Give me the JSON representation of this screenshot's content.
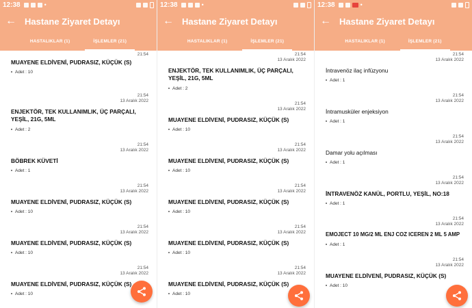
{
  "status_bar": {
    "time": "12:38"
  },
  "app_bar": {
    "back_icon": "arrow-left-icon",
    "title": "Hastane Ziyaret Detayı"
  },
  "tabs": [
    {
      "label": "HASTALIKLAR (1)",
      "active": false
    },
    {
      "label": "İŞLEMLER (21)",
      "active": true
    }
  ],
  "colors": {
    "header": "#f6ad86",
    "fab": "#ff6f3c"
  },
  "fab": {
    "icon": "share-icon"
  },
  "panels": [
    {
      "items": [
        {
          "time": "21:54",
          "date": "",
          "name": "MUAYENE ELDİVENİ, PUDRASIZ, KÜÇÜK (S)",
          "qty": "Adet : 10"
        },
        {
          "time": "21:54",
          "date": "13 Aralık 2022",
          "name": "ENJEKTÖR, TEK KULLANIMLIK, ÜÇ PARÇALI, YEŞİL, 21G, 5ML",
          "qty": "Adet : 2"
        },
        {
          "time": "21:54",
          "date": "13 Aralık 2022",
          "name": "BÖBREK KÜVETİ",
          "qty": "Adet : 1"
        },
        {
          "time": "21:54",
          "date": "13 Aralık 2022",
          "name": "MUAYENE ELDİVENİ, PUDRASIZ, KÜÇÜK (S)",
          "qty": "Adet : 10"
        },
        {
          "time": "21:54",
          "date": "13 Aralık 2022",
          "name": "MUAYENE ELDİVENİ, PUDRASIZ, KÜÇÜK (S)",
          "qty": "Adet : 10"
        },
        {
          "time": "21:54",
          "date": "13 Aralık 2022",
          "name": "MUAYENE ELDİVENİ, PUDRASIZ, KÜÇÜK (S)",
          "qty": "Adet : 10"
        }
      ]
    },
    {
      "items": [
        {
          "time": "21:54",
          "date": "13 Aralık 2022",
          "name": "ENJEKTÖR, TEK KULLANIMLIK, ÜÇ PARÇALI, YEŞİL, 21G, 5ML",
          "qty": "Adet : 2"
        },
        {
          "time": "21:54",
          "date": "13 Aralık 2022",
          "name": "MUAYENE ELDİVENİ, PUDRASIZ, KÜÇÜK (S)",
          "qty": "Adet : 10"
        },
        {
          "time": "21:54",
          "date": "13 Aralık 2022",
          "name": "MUAYENE ELDİVENİ, PUDRASIZ, KÜÇÜK (S)",
          "qty": "Adet : 10"
        },
        {
          "time": "21:54",
          "date": "13 Aralık 2022",
          "name": "MUAYENE ELDİVENİ, PUDRASIZ, KÜÇÜK (S)",
          "qty": "Adet : 10"
        },
        {
          "time": "21:54",
          "date": "13 Aralık 2022",
          "name": "MUAYENE ELDİVENİ, PUDRASIZ, KÜÇÜK (S)",
          "qty": "Adet : 10"
        },
        {
          "time": "21:54",
          "date": "13 Aralık 2022",
          "name": "MUAYENE ELDİVENİ, PUDRASIZ, KÜÇÜK (S)",
          "qty": "Adet : 10"
        }
      ]
    },
    {
      "items": [
        {
          "time": "21:54",
          "date": "13 Aralık 2022",
          "name": "İntravenöz ilaç infüzyonu",
          "qty": "Adet : 1"
        },
        {
          "time": "21:54",
          "date": "13 Aralık 2022",
          "name": "İntramusküler enjeksiyon",
          "qty": "Adet : 1"
        },
        {
          "time": "21:54",
          "date": "13 Aralık 2022",
          "name": "Damar yolu açılması",
          "qty": "Adet : 1"
        },
        {
          "time": "21:54",
          "date": "13 Aralık 2022",
          "name": "İNTRAVENÖZ KANÜL, PORTLU, YEŞİL, NO:18",
          "qty": "Adet : 1"
        },
        {
          "time": "21:54",
          "date": "13 Aralık 2022",
          "name": "EMOJECT 10 MG/2 ML ENJ COZ ICEREN  2 ML 5 AMP",
          "qty": "Adet : 1"
        },
        {
          "time": "21:54",
          "date": "13 Aralık 2022",
          "name": "MUAYENE ELDİVENİ, PUDRASIZ, KÜÇÜK (S)",
          "qty": "Adet : 10"
        }
      ]
    }
  ]
}
